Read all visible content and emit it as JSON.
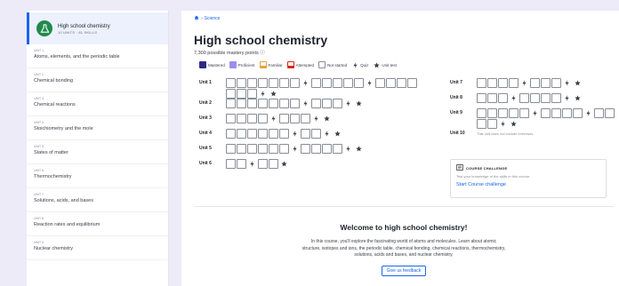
{
  "sidebar": {
    "course": {
      "title": "High school chemistry",
      "subtitle": "10 UNITS · 81 SKILLS"
    },
    "units": [
      {
        "label": "UNIT 1",
        "name": "Atoms, elements, and the periodic table"
      },
      {
        "label": "UNIT 2",
        "name": "Chemical bonding"
      },
      {
        "label": "UNIT 3",
        "name": "Chemical reactions"
      },
      {
        "label": "UNIT 4",
        "name": "Stoichiometry and the mole"
      },
      {
        "label": "UNIT 5",
        "name": "States of matter"
      },
      {
        "label": "UNIT 6",
        "name": "Thermochemistry"
      },
      {
        "label": "UNIT 7",
        "name": "Solutions, acids, and bases"
      },
      {
        "label": "UNIT 8",
        "name": "Reaction rates and equilibrium"
      },
      {
        "label": "UNIT 9",
        "name": "Nuclear chemistry"
      }
    ]
  },
  "breadcrumb": {
    "separator": "›",
    "item": "Science"
  },
  "page": {
    "title": "High school chemistry",
    "mastery_points": "7,300 possible mastery points ⓘ"
  },
  "legend": {
    "mastered": "Mastered",
    "proficient": "Proficient",
    "familiar": "Familiar",
    "attempted": "Attempted",
    "not_started": "Not started",
    "quiz": "Quiz",
    "unit_test": "Unit test"
  },
  "units_left": [
    {
      "label": "Unit 1",
      "items": "bbbbbbbqbbbbbqbbbbbbbqt"
    },
    {
      "label": "Unit 2",
      "items": "bbbbbbbqbbbqt"
    },
    {
      "label": "Unit 3",
      "items": "bbbbqbbbqt"
    },
    {
      "label": "Unit 4",
      "items": "bbbbbbqbbqt"
    },
    {
      "label": "Unit 5",
      "items": "bbbbbbqbbbbqt"
    },
    {
      "label": "Unit 6",
      "items": "bbqbbt"
    }
  ],
  "units_right": [
    {
      "label": "Unit 7",
      "items": "bbbbqbbbqt"
    },
    {
      "label": "Unit 8",
      "items": "bbbqbbbbqt"
    },
    {
      "label": "Unit 9",
      "items": "bbbbbqbbbbqbbbbqt"
    },
    {
      "label": "Unit 10",
      "note": "This unit does not include exercises."
    }
  ],
  "challenge": {
    "heading": "COURSE CHALLENGE",
    "description": "Test your knowledge of the skills in this course.",
    "link": "Start Course challenge"
  },
  "welcome": {
    "title": "Welcome to high school chemistry!",
    "body": "In this course, you'll explore the fascinating world of atoms and molecules. Learn about atomic structure, isotopes and ions, the periodic table, chemical bonding, chemical reactions, thermochemistry, solutions, acids and bases, and nuclear chemistry.",
    "button": "Give us feedback"
  },
  "colors": {
    "accent": "#1865f2",
    "mastered": "#2d2a85",
    "proficient": "#9b8ef0",
    "familiar": "#e5a33b",
    "attempted": "#d92916"
  }
}
